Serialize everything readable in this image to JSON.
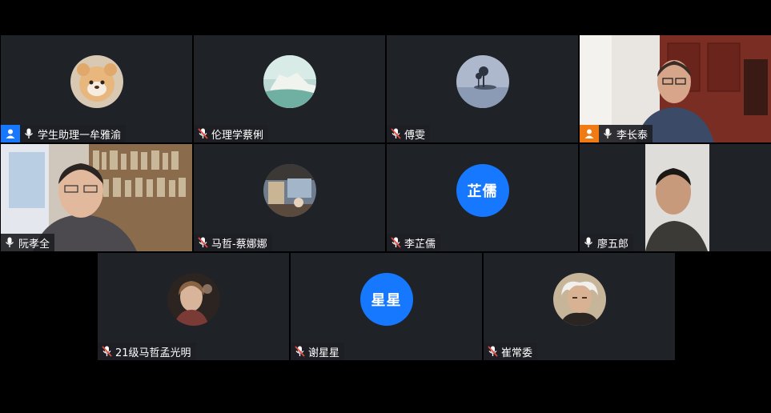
{
  "participants": [
    {
      "name": "学生助理一牟雅渝",
      "muted": false,
      "host_icon": "user-icon",
      "avatar": "bear-costume-avatar"
    },
    {
      "name": "伦理学蔡俐",
      "muted": true,
      "avatar": "white-cliffs-avatar"
    },
    {
      "name": "傅雯",
      "muted": true,
      "avatar": "tree-island-avatar"
    },
    {
      "name": "李长泰",
      "muted": false,
      "host_icon": "user-icon",
      "video": "man-with-glasses-video"
    },
    {
      "name": "阮孝全",
      "muted": false,
      "video": "man-bookshelf-video"
    },
    {
      "name": "马哲-蔡娜娜",
      "muted": true,
      "avatar": "room-scene-avatar"
    },
    {
      "name": "李芷儒",
      "muted": true,
      "avatar_text": "芷儒"
    },
    {
      "name": "廖五郎",
      "muted": false,
      "video": "man-window-video",
      "active_speaker": true
    },
    {
      "name": "21级马哲孟光明",
      "muted": true,
      "avatar": "portrait-woman-avatar"
    },
    {
      "name": "谢星星",
      "muted": true,
      "avatar_text": "星星"
    },
    {
      "name": "崔常委",
      "muted": true,
      "avatar": "schopenhauer-portrait-avatar"
    }
  ],
  "colors": {
    "tile_bg": "#1f2227",
    "avatar_blue": "#1677ff",
    "host_blue": "#1677ff",
    "host_orange": "#f07b14",
    "active_border": "#2aa55e",
    "muted_red": "#e5483f"
  }
}
